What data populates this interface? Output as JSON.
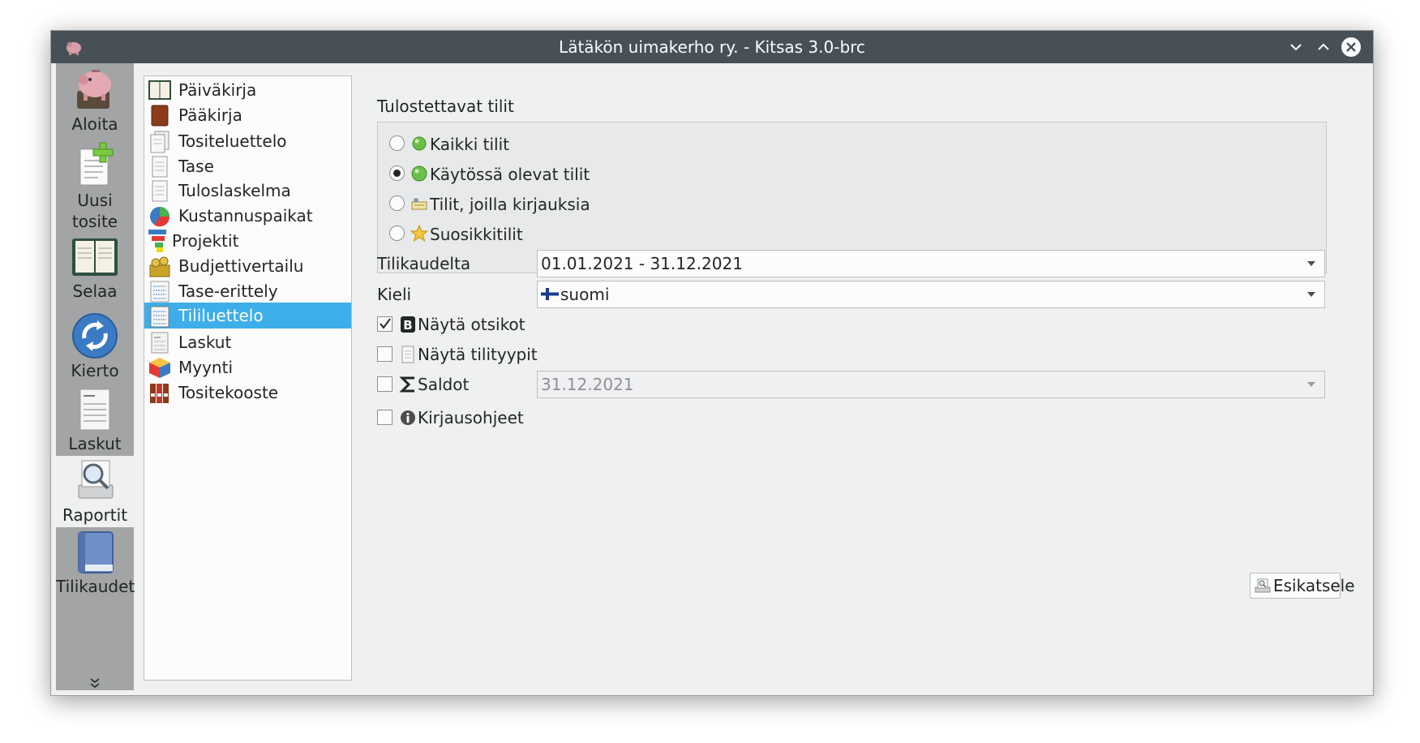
{
  "window": {
    "title": "Lätäkön uimakerho ry. - Kitsas 3.0-brc"
  },
  "sidebar": {
    "items": [
      {
        "label": "Aloita",
        "icon": "piggy-bank-icon"
      },
      {
        "label": "Uusi tosite",
        "icon": "new-document-icon"
      },
      {
        "label": "Selaa",
        "icon": "ledger-book-icon"
      },
      {
        "label": "Kierto",
        "icon": "circulation-icon"
      },
      {
        "label": "Laskut",
        "icon": "invoice-icon"
      },
      {
        "label": "Raportit",
        "icon": "report-search-icon",
        "active": true
      },
      {
        "label": "Tilikaudet",
        "icon": "book-icon"
      }
    ]
  },
  "reports": {
    "items": [
      {
        "label": "Päiväkirja"
      },
      {
        "label": "Pääkirja"
      },
      {
        "label": "Tositeluettelo"
      },
      {
        "label": "Tase"
      },
      {
        "label": "Tuloslaskelma"
      },
      {
        "label": "Kustannuspaikat"
      },
      {
        "label": "Projektit"
      },
      {
        "label": "Budjettivertailu"
      },
      {
        "label": "Tase-erittely"
      },
      {
        "label": "Tililuettelo",
        "selected": true
      },
      {
        "label": "Laskut"
      },
      {
        "label": "Myynti"
      },
      {
        "label": "Tositekooste"
      }
    ]
  },
  "accounts": {
    "title": "Tulostettavat tilit",
    "options": [
      {
        "label": "Kaikki tilit",
        "checked": false
      },
      {
        "label": "Käytössä olevat tilit",
        "checked": true
      },
      {
        "label": "Tilit, joilla kirjauksia",
        "checked": false
      },
      {
        "label": "Suosikkitilit",
        "checked": false
      }
    ]
  },
  "form": {
    "period_label": "Tilikaudelta",
    "period_value": "01.01.2021 - 31.12.2021",
    "language_label": "Kieli",
    "language_value": "suomi",
    "show_headers_label": "Näytä otsikot",
    "show_headers_checked": true,
    "show_types_label": "Näytä tilityypit",
    "show_types_checked": false,
    "balances_label": "Saldot",
    "balances_checked": false,
    "balances_date": "31.12.2021",
    "instructions_label": "Kirjausohjeet",
    "instructions_checked": false
  },
  "preview_button": "Esikatsele",
  "colors": {
    "titlebar": "#475057",
    "selection": "#3daee9",
    "window_bg": "#eff0f1",
    "sidebar_bg": "#a3a4a6"
  }
}
